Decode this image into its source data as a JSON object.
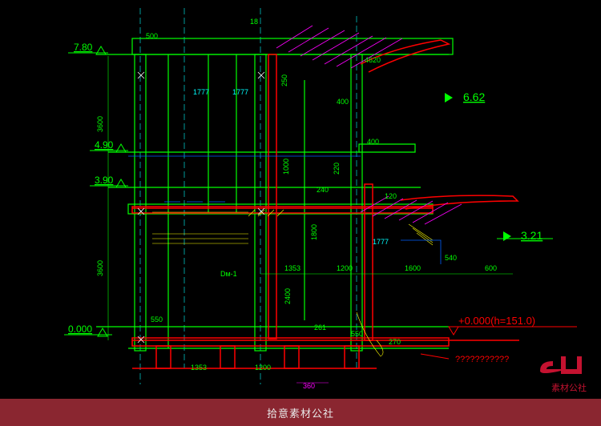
{
  "footer": {
    "text": "拾意素材公社"
  },
  "logo": {
    "main": "SH",
    "sub": "素材公社"
  },
  "elevations": {
    "top": "7.80",
    "mid1": "4.90",
    "mid2": "3.90",
    "zero": "0.000",
    "roof_annot": "6.62",
    "side_annot": "3.21",
    "datum": "+0.000(h=151.0)"
  },
  "dims": {
    "d3600": "3600",
    "d3600b": "3600",
    "d500": "500",
    "d250": "250",
    "d220": "220",
    "d240": "240",
    "d400": "400",
    "d4620": "4620",
    "d1353": "1353",
    "d1200": "1200",
    "d1600": "1600",
    "d540": "540",
    "d600": "600",
    "d120": "120",
    "d1777a": "1777",
    "d1777b": "1777",
    "d1777c": "1777",
    "d550a": "550",
    "d550b": "550",
    "d270": "270",
    "d360": "360",
    "d261": "261",
    "d2400": "2400",
    "d1800": "1800",
    "d1000": "1000",
    "d18": "18"
  },
  "labels": {
    "dm1": "Dм-1",
    "unknown": "???????????"
  },
  "colors": {
    "green": "#00ff00",
    "red": "#ff0000",
    "cyan": "#00ffff",
    "yellow": "#ffff00",
    "blue": "#0060ff",
    "magenta": "#ff00ff",
    "white": "#ffffff"
  }
}
